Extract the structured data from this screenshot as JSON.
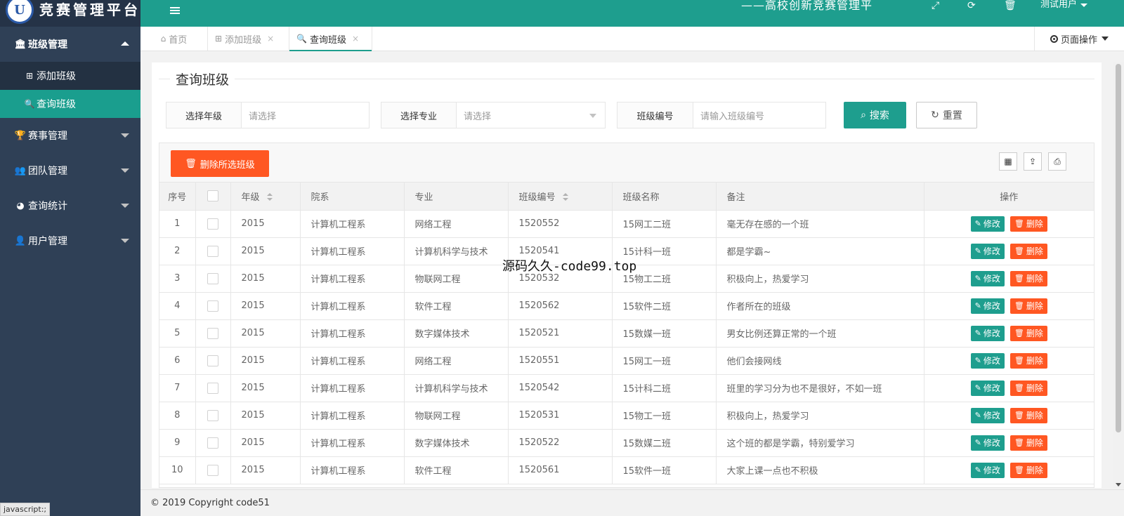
{
  "brand": {
    "logo_letter": "U",
    "title": "竞赛管理平台"
  },
  "sidebar": {
    "groups": [
      {
        "label": "班级管理",
        "icon": "🏛",
        "open": true,
        "children": [
          {
            "label": "添加班级",
            "icon": "⊞",
            "active": false
          },
          {
            "label": "查询班级",
            "icon": "🔍",
            "active": true
          }
        ]
      },
      {
        "label": "赛事管理",
        "icon": "🏆"
      },
      {
        "label": "团队管理",
        "icon": "👥"
      },
      {
        "label": "查询统计",
        "icon": "◕"
      },
      {
        "label": "用户管理",
        "icon": "👤"
      }
    ]
  },
  "header": {
    "title": "——高校创新竞赛管理平",
    "icons": [
      "fullscreen-icon",
      "refresh-icon",
      "trash-icon"
    ],
    "user": "测试用户"
  },
  "tabs": [
    {
      "label": "首页",
      "icon": "home-icon",
      "closable": false
    },
    {
      "label": "添加班级",
      "icon": "plus-square-icon",
      "closable": true
    },
    {
      "label": "查询班级",
      "icon": "search-icon",
      "closable": true,
      "active": true
    }
  ],
  "page_ops": "页面操作",
  "panel": {
    "title": "查询班级",
    "filters": {
      "grade": {
        "label": "选择年级",
        "placeholder": "请选择"
      },
      "major": {
        "label": "选择专业",
        "placeholder": "请选择"
      },
      "class_no": {
        "label": "班级编号",
        "placeholder": "请输入班级编号"
      }
    },
    "search_button": "搜索",
    "reset_button": "重置",
    "delete_selected_button": "删除所选班级"
  },
  "table": {
    "columns": [
      "序号",
      "",
      "年级",
      "院系",
      "专业",
      "班级编号",
      "班级名称",
      "备注",
      "操作"
    ],
    "edit_label": "修改",
    "delete_label": "删除",
    "rows": [
      [
        "1",
        "2015",
        "计算机工程系",
        "网络工程",
        "1520552",
        "15网工二班",
        "毫无存在感的一个班"
      ],
      [
        "2",
        "2015",
        "计算机工程系",
        "计算机科学与技术",
        "1520541",
        "15计科一班",
        "都是学霸~"
      ],
      [
        "3",
        "2015",
        "计算机工程系",
        "物联网工程",
        "1520532",
        "15物工二班",
        "积极向上，热爱学习"
      ],
      [
        "4",
        "2015",
        "计算机工程系",
        "软件工程",
        "1520562",
        "15软件二班",
        "作者所在的班级"
      ],
      [
        "5",
        "2015",
        "计算机工程系",
        "数字媒体技术",
        "1520521",
        "15数媒一班",
        "男女比例还算正常的一个班"
      ],
      [
        "6",
        "2015",
        "计算机工程系",
        "网络工程",
        "1520551",
        "15网工一班",
        "他们会接网线"
      ],
      [
        "7",
        "2015",
        "计算机工程系",
        "计算机科学与技术",
        "1520542",
        "15计科二班",
        "班里的学习分为也不是很好，不如一班"
      ],
      [
        "8",
        "2015",
        "计算机工程系",
        "物联网工程",
        "1520531",
        "15物工一班",
        "积极向上，热爱学习"
      ],
      [
        "9",
        "2015",
        "计算机工程系",
        "数字媒体技术",
        "1520522",
        "15数媒二班",
        "这个班的都是学霸，特别爱学习"
      ],
      [
        "10",
        "2015",
        "计算机工程系",
        "软件工程",
        "1520561",
        "15软件一班",
        "大家上课一点也不积极"
      ]
    ]
  },
  "watermark": "源码久久-code99.top",
  "footer": "© 2019 Copyright code51",
  "status_url": "javascript:;",
  "colors": {
    "primary": "#1e9e8e",
    "danger": "#ff5722",
    "sidebar": "#2f4056"
  }
}
